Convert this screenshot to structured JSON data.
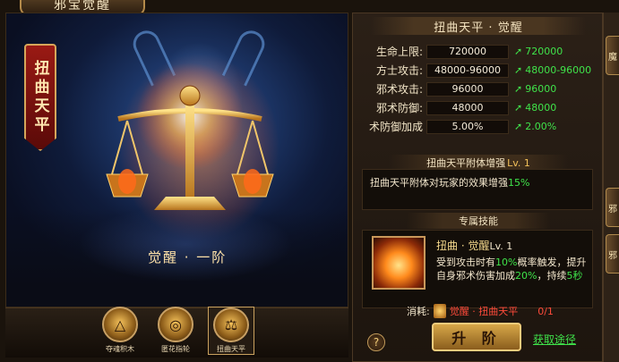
{
  "window": {
    "title": "邪宝觉醒"
  },
  "artifact": {
    "name": "扭曲天平",
    "stage": "觉醒 · 一阶"
  },
  "tabs": [
    {
      "label": "夺魂积木",
      "icon": "△",
      "active": false
    },
    {
      "label": "匿花指轮",
      "icon": "◎",
      "active": false
    },
    {
      "label": "扭曲天平",
      "icon": "⚖",
      "active": true
    }
  ],
  "panel": {
    "title": "扭曲天平 · 觉醒",
    "stats": [
      {
        "label": "生命上限:",
        "value": "720000",
        "next": "720000"
      },
      {
        "label": "方士攻击:",
        "value": "48000-96000",
        "next": "48000-96000"
      },
      {
        "label": "邪术攻击:",
        "value": "96000",
        "next": "96000"
      },
      {
        "label": "邪术防御:",
        "value": "48000",
        "next": "48000"
      },
      {
        "label": "术防御加成",
        "value": "5.00%",
        "next": "2.00%"
      }
    ],
    "enhance": {
      "title": "扭曲天平附体增强",
      "level": "Lv. 1",
      "desc_prefix": "扭曲天平附体对玩家的效果增强",
      "desc_value": "15%"
    },
    "skill": {
      "section_title": "专属技能",
      "name": "扭曲 · 觉醒",
      "level": "Lv. 1",
      "d1": "受到攻击时有",
      "d2": "10%",
      "d3": "概率触发，提升自身邪术伤害加成",
      "d4": "20%",
      "d5": "，持续",
      "d6": "5秒"
    },
    "cost": {
      "label": "消耗:",
      "item": "觉醒 · 扭曲天平",
      "count": "0/1"
    },
    "help_icon": "?",
    "upgrade_label": "升 阶",
    "acquire_label": "获取途径"
  },
  "side_tabs": [
    "魔",
    "邪",
    "邪"
  ],
  "colors": {
    "accent": "#d7a748",
    "green": "#3fe34a",
    "red": "#ff4a3a"
  }
}
